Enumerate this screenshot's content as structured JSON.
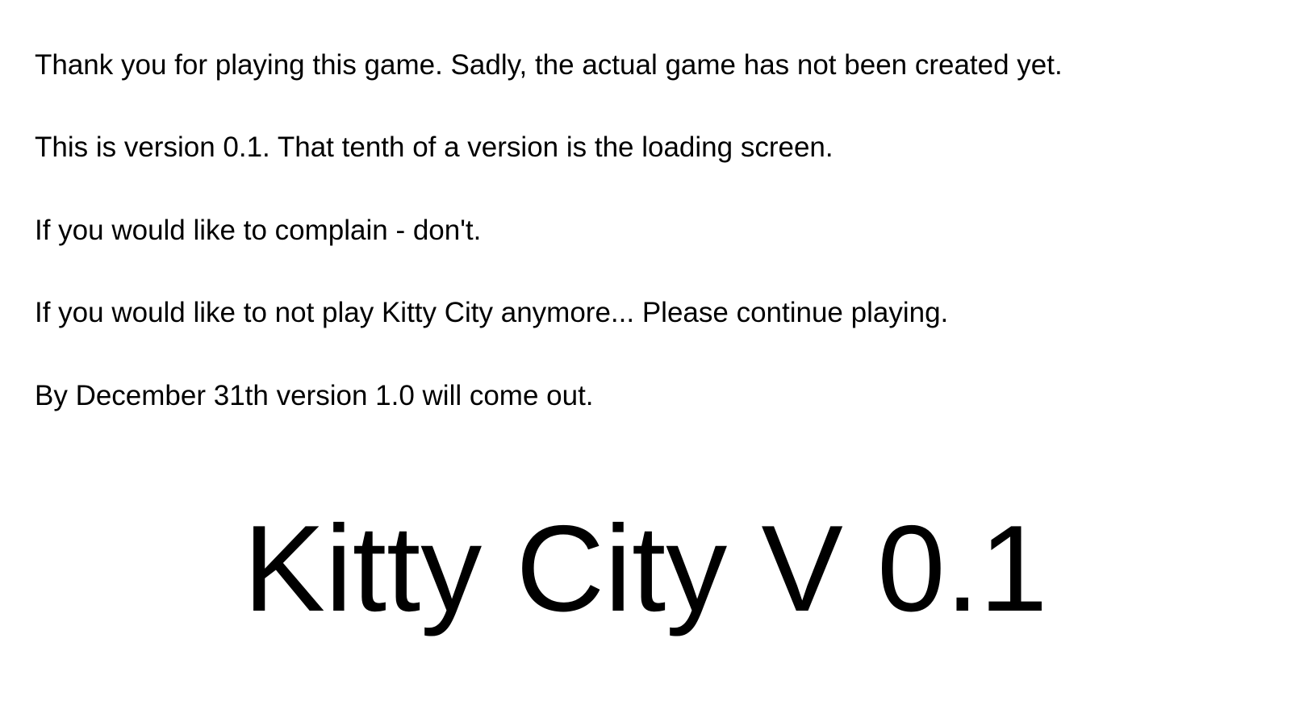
{
  "screen": {
    "background_color": "#ffffff",
    "text_color": "#000000"
  },
  "intro": {
    "lines": [
      "Thank you for playing this game. Sadly, the actual game has not been created yet.",
      "This is version 0.1. That tenth of a version is the loading screen.",
      "If you would like to complain - don't.",
      "If you would like to not play Kitty City anymore... Please continue playing.",
      "By December 31th version 1.0 will come out."
    ]
  },
  "title": {
    "text": "Kitty City V 0.1"
  }
}
